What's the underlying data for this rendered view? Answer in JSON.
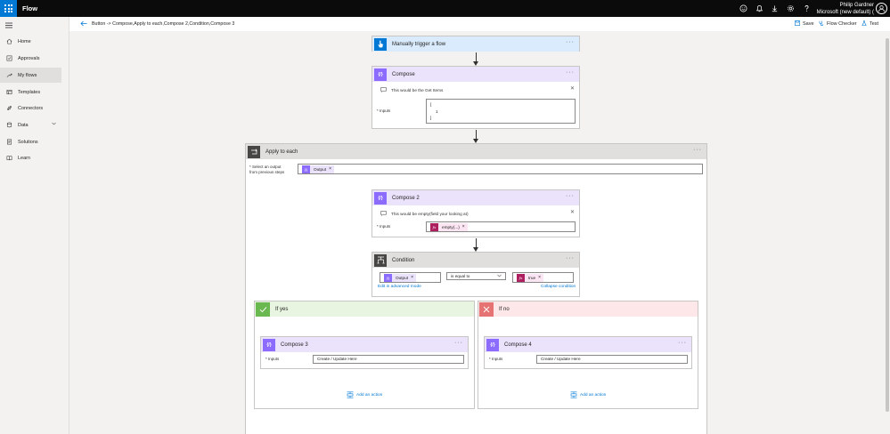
{
  "topbar": {
    "app_title": "Flow",
    "user_name": "Philip Gardner",
    "environment": "Microsoft (new default) ("
  },
  "nav": {
    "items": [
      {
        "label": "Home",
        "icon": "home-icon"
      },
      {
        "label": "Approvals",
        "icon": "approvals-icon"
      },
      {
        "label": "My flows",
        "icon": "flows-icon"
      },
      {
        "label": "Templates",
        "icon": "templates-icon"
      },
      {
        "label": "Connectors",
        "icon": "connectors-icon"
      },
      {
        "label": "Data",
        "icon": "data-icon"
      },
      {
        "label": "Solutions",
        "icon": "solutions-icon"
      },
      {
        "label": "Learn",
        "icon": "learn-icon"
      }
    ]
  },
  "cmdbar": {
    "breadcrumb": "Button -> Compose,Apply to each,Compose 2,Condition,Compose 3",
    "save": "Save",
    "flow_checker": "Flow Checker",
    "test": "Test"
  },
  "flow": {
    "dots": "···",
    "trigger": {
      "title": "Manually trigger a flow"
    },
    "compose": {
      "title": "Compose",
      "comment": "This would be the Get Items",
      "inputs_label": "* Inputs",
      "inputs_lines": [
        "[",
        "1",
        "]"
      ]
    },
    "apply_each": {
      "title": "Apply to each",
      "select_label_1": "* Select an output",
      "select_label_2": "from previous steps",
      "token": "Output"
    },
    "compose2": {
      "title": "Compose 2",
      "comment": "This would be empty(field your looking at)",
      "inputs_label": "* Inputs",
      "token": "empty(...)"
    },
    "condition": {
      "title": "Condition",
      "left_token": "Output",
      "operator": "is equal to",
      "right_token": "true",
      "edit_advanced": "Edit in advanced mode",
      "collapse": "Collapse condition"
    },
    "if_yes": {
      "title": "If yes",
      "action_title": "Compose 3",
      "inputs_label": "* Inputs",
      "inputs_value": "Create / Update Here",
      "add_action": "Add an action"
    },
    "if_no": {
      "title": "If no",
      "action_title": "Compose 4",
      "inputs_label": "* Inputs",
      "inputs_value": "Create / Update Here",
      "add_action": "Add an action"
    }
  },
  "colors": {
    "brand": "#0078d4",
    "compose": "#8c6cff",
    "yes": "#6ab850",
    "no": "#e57373",
    "expression": "#ad1f5e"
  }
}
